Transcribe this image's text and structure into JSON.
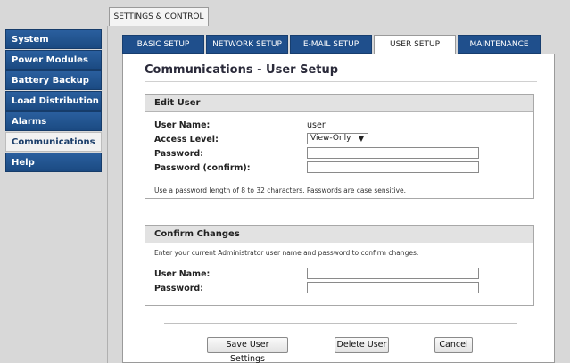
{
  "top_tab": "SETTINGS & CONTROL",
  "sidebar": {
    "items": [
      {
        "label": "System"
      },
      {
        "label": "Power Modules"
      },
      {
        "label": "Battery Backup"
      },
      {
        "label": "Load Distribution"
      },
      {
        "label": "Alarms"
      },
      {
        "label": "Communications",
        "active": true
      },
      {
        "label": "Help"
      }
    ]
  },
  "tabs": [
    {
      "label": "BASIC SETUP"
    },
    {
      "label": "NETWORK SETUP"
    },
    {
      "label": "E-MAIL SETUP"
    },
    {
      "label": "USER SETUP",
      "active": true
    },
    {
      "label": "MAINTENANCE"
    }
  ],
  "page_title": "Communications - User Setup",
  "edit_user": {
    "heading": "Edit User",
    "user_name_label": "User Name:",
    "user_name_value": "user",
    "access_level_label": "Access Level:",
    "access_level_value": "View-Only",
    "password_label": "Password:",
    "password_confirm_label": "Password (confirm):",
    "password_value": "",
    "password_confirm_value": "",
    "note": "Use a password length of 8 to 32 characters. Passwords are case sensitive."
  },
  "confirm_changes": {
    "heading": "Confirm Changes",
    "instruction": "Enter your current Administrator user name and password to confirm changes.",
    "user_name_label": "User Name:",
    "password_label": "Password:",
    "user_name_value": "",
    "password_value": ""
  },
  "buttons": {
    "save": "Save User Settings",
    "delete": "Delete User",
    "cancel": "Cancel"
  },
  "colors": {
    "nav_blue": "#1f4f8c",
    "panel_bg": "#ffffff",
    "frame_bg": "#d8d8d8"
  }
}
